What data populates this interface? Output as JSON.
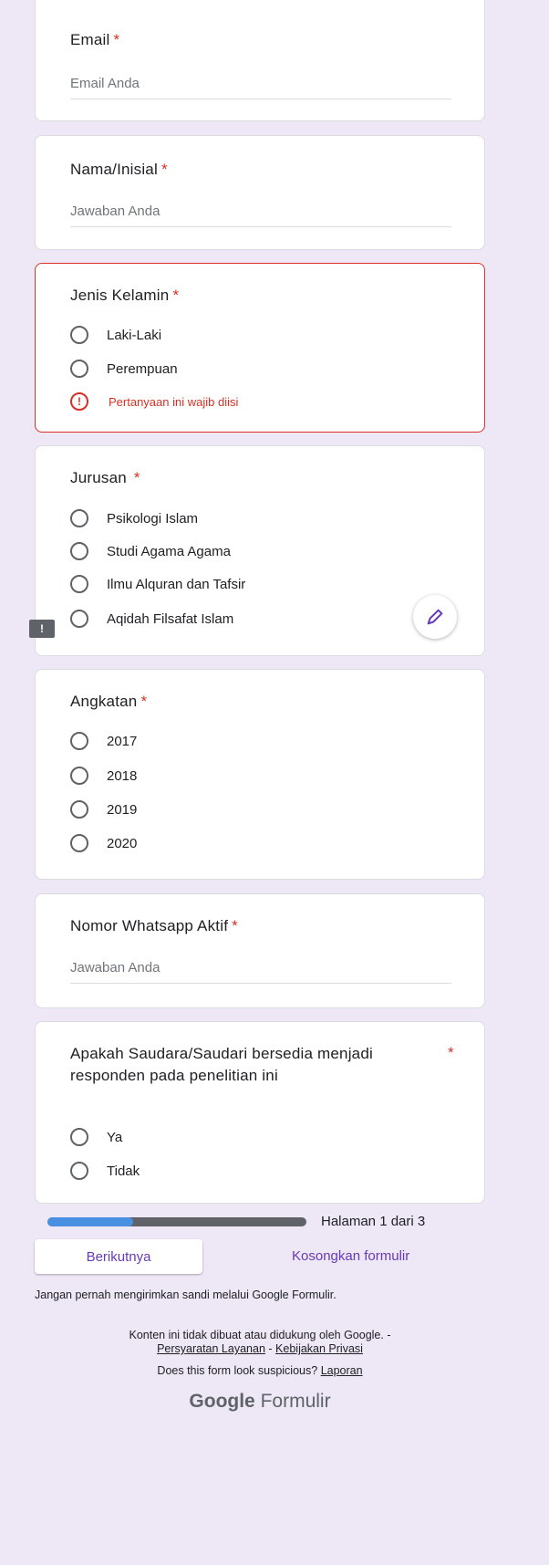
{
  "questions": {
    "email": {
      "title": "Email",
      "required_mark": "*",
      "placeholder": "Email Anda"
    },
    "nama": {
      "title": "Nama/Inisial",
      "required_mark": "*",
      "placeholder": "Jawaban Anda"
    },
    "jenis_kelamin": {
      "title": "Jenis Kelamin",
      "required_mark": "*",
      "options": [
        "Laki-Laki",
        "Perempuan"
      ],
      "error_text": "Pertanyaan ini wajib diisi"
    },
    "jurusan": {
      "title": "Jurusan",
      "required_mark": "*",
      "options": [
        "Psikologi Islam",
        "Studi Agama Agama",
        "Ilmu Alquran dan Tafsir",
        "Aqidah Filsafat Islam"
      ]
    },
    "angkatan": {
      "title": "Angkatan",
      "required_mark": "*",
      "options": [
        "2017",
        "2018",
        "2019",
        "2020"
      ]
    },
    "whatsapp": {
      "title": "Nomor Whatsapp Aktif",
      "required_mark": "*",
      "placeholder": "Jawaban Anda"
    },
    "kesediaan": {
      "title": "Apakah Saudara/Saudari bersedia menjadi responden pada penelitian ini",
      "required_mark": "*",
      "options": [
        "Ya",
        "Tidak"
      ]
    }
  },
  "progress": {
    "fraction": 0.33,
    "label": "Halaman 1 dari 3"
  },
  "actions": {
    "next_label": "Berikutnya",
    "clear_label": "Kosongkan formulir"
  },
  "footer": {
    "warning": "Jangan pernah mengirimkan sandi melalui Google Formulir.",
    "disclaimer": "Konten ini tidak dibuat atau didukung oleh Google. -",
    "terms": "Persyaratan Layanan",
    "separator": "-",
    "privacy": "Kebijakan Privasi",
    "suspicious": "Does this form look suspicious?",
    "report": "Laporan",
    "brand_google": "Google",
    "brand_forms": "Formulir"
  },
  "icons": {
    "error_icon": "exclamation-circle-icon",
    "edit_icon": "pencil-icon",
    "feedback_icon": "feedback-icon"
  },
  "colors": {
    "background": "#ede7f6",
    "accent": "#673ab7",
    "error": "#d93025",
    "progress_fill": "#4a90e2"
  }
}
